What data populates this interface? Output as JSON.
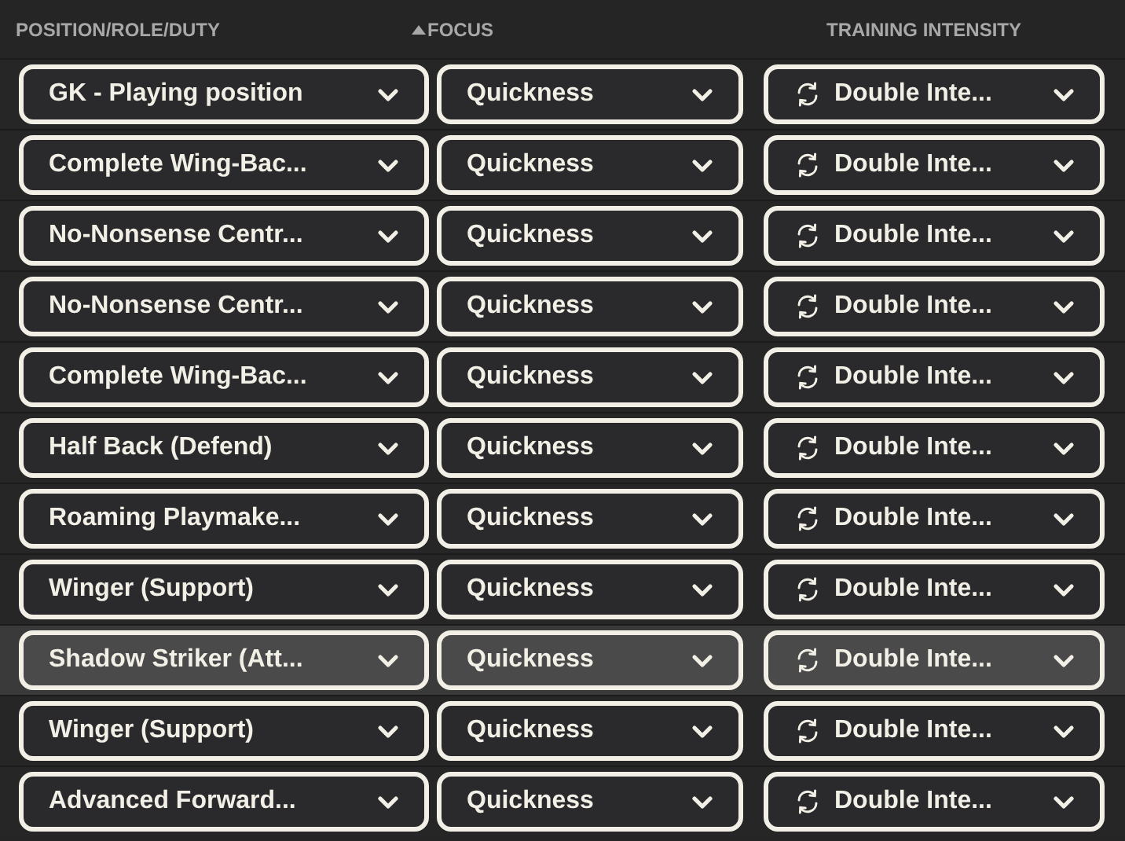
{
  "columns": [
    {
      "label": "POSITION/ROLE/DUTY",
      "sorted": false
    },
    {
      "label": "FOCUS",
      "sorted": true
    },
    {
      "label": "TRAINING INTENSITY",
      "sorted": false
    }
  ],
  "rows": [
    {
      "role": "GK - Playing position",
      "focus": "Quickness",
      "intensity": "Double Inte...",
      "selected": false
    },
    {
      "role": "Complete Wing-Bac...",
      "focus": "Quickness",
      "intensity": "Double Inte...",
      "selected": false
    },
    {
      "role": "No-Nonsense Centr...",
      "focus": "Quickness",
      "intensity": "Double Inte...",
      "selected": false
    },
    {
      "role": "No-Nonsense Centr...",
      "focus": "Quickness",
      "intensity": "Double Inte...",
      "selected": false
    },
    {
      "role": "Complete Wing-Bac...",
      "focus": "Quickness",
      "intensity": "Double Inte...",
      "selected": false
    },
    {
      "role": "Half Back (Defend)",
      "focus": "Quickness",
      "intensity": "Double Inte...",
      "selected": false
    },
    {
      "role": "Roaming Playmake...",
      "focus": "Quickness",
      "intensity": "Double Inte...",
      "selected": false
    },
    {
      "role": "Winger (Support)",
      "focus": "Quickness",
      "intensity": "Double Inte...",
      "selected": false
    },
    {
      "role": "Shadow Striker (Att...",
      "focus": "Quickness",
      "intensity": "Double Inte...",
      "selected": true
    },
    {
      "role": "Winger (Support)",
      "focus": "Quickness",
      "intensity": "Double Inte...",
      "selected": false
    },
    {
      "role": "Advanced Forward...",
      "focus": "Quickness",
      "intensity": "Double Inte...",
      "selected": false
    }
  ]
}
